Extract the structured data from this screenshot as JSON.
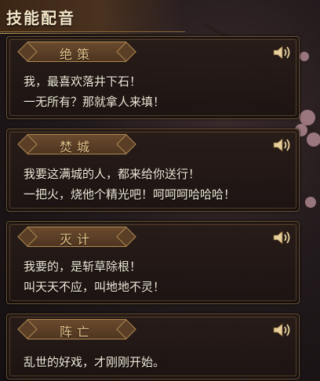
{
  "panel": {
    "title": "技能配音"
  },
  "skills": [
    {
      "name": "绝策",
      "lines": [
        "我，最喜欢落井下石！",
        "一无所有？那就拿人来填！"
      ]
    },
    {
      "name": "焚城",
      "lines": [
        "我要这满城的人，都来给你送行！",
        "一把火，烧他个精光吧！呵呵呵哈哈哈！"
      ]
    },
    {
      "name": "灭计",
      "lines": [
        "我要的，是斩草除根！",
        "叫天天不应，叫地地不灵！"
      ]
    },
    {
      "name": "阵亡",
      "lines": [
        "乱世的好戏，才刚刚开始。"
      ]
    }
  ],
  "icons": {
    "play_voice": "speaker-icon"
  },
  "colors": {
    "accent_gold": "#c9a25b",
    "tag_text": "#e8c68c",
    "body_text": "#f1ead9"
  }
}
